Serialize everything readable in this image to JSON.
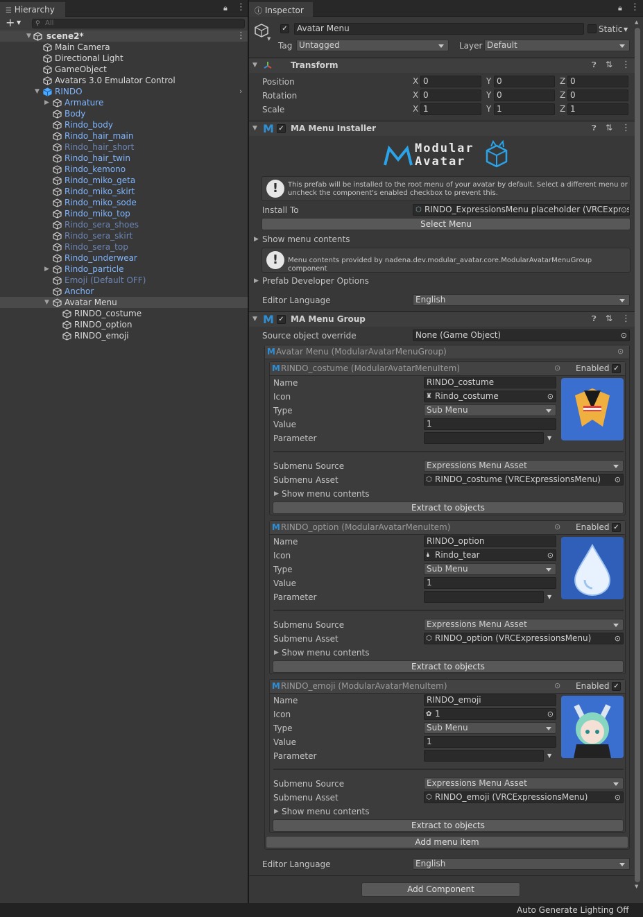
{
  "hierarchy": {
    "tab": "Hierarchy",
    "search_placeholder": "All",
    "scene": "scene2*",
    "rows": [
      {
        "label": "Main Camera",
        "indent": 1,
        "color": "white",
        "icon": "gameobject-icon"
      },
      {
        "label": "Directional Light",
        "indent": 1,
        "color": "white",
        "icon": "gameobject-icon"
      },
      {
        "label": "GameObject",
        "indent": 1,
        "color": "white",
        "icon": "gameobject-icon"
      },
      {
        "label": "Avatars 3.0 Emulator Control",
        "indent": 1,
        "color": "white",
        "icon": "gameobject-icon"
      },
      {
        "label": "RINDO",
        "indent": 1,
        "color": "blue",
        "icon": "prefab-icon",
        "expanded": true
      },
      {
        "label": "Armature",
        "indent": 2,
        "color": "blue",
        "icon": "gameobject-icon",
        "collapsed": true
      },
      {
        "label": "Body",
        "indent": 2,
        "color": "blue",
        "icon": "gameobject-icon"
      },
      {
        "label": "Rindo_body",
        "indent": 2,
        "color": "blue",
        "icon": "gameobject-icon"
      },
      {
        "label": "Rindo_hair_main",
        "indent": 2,
        "color": "blue",
        "icon": "gameobject-icon"
      },
      {
        "label": "Rindo_hair_short",
        "indent": 2,
        "color": "dim",
        "icon": "gameobject-icon"
      },
      {
        "label": "Rindo_hair_twin",
        "indent": 2,
        "color": "blue",
        "icon": "gameobject-icon"
      },
      {
        "label": "Rindo_kemono",
        "indent": 2,
        "color": "blue",
        "icon": "gameobject-icon"
      },
      {
        "label": "Rindo_miko_geta",
        "indent": 2,
        "color": "blue",
        "icon": "gameobject-icon"
      },
      {
        "label": "Rindo_miko_skirt",
        "indent": 2,
        "color": "blue",
        "icon": "gameobject-icon"
      },
      {
        "label": "Rindo_miko_sode",
        "indent": 2,
        "color": "blue",
        "icon": "gameobject-icon"
      },
      {
        "label": "Rindo_miko_top",
        "indent": 2,
        "color": "blue",
        "icon": "gameobject-icon"
      },
      {
        "label": "Rindo_sera_shoes",
        "indent": 2,
        "color": "dim",
        "icon": "gameobject-icon"
      },
      {
        "label": "Rindo_sera_skirt",
        "indent": 2,
        "color": "dim",
        "icon": "gameobject-icon"
      },
      {
        "label": "Rindo_sera_top",
        "indent": 2,
        "color": "dim",
        "icon": "gameobject-icon"
      },
      {
        "label": "Rindo_underwear",
        "indent": 2,
        "color": "blue",
        "icon": "gameobject-icon"
      },
      {
        "label": "Rindo_particle",
        "indent": 2,
        "color": "blue",
        "icon": "gameobject-icon",
        "collapsed": true
      },
      {
        "label": "Emoji (Default OFF)",
        "indent": 2,
        "color": "dim",
        "icon": "gameobject-icon"
      },
      {
        "label": "Anchor",
        "indent": 2,
        "color": "blue",
        "icon": "gameobject-icon"
      },
      {
        "label": "Avatar Menu",
        "indent": 2,
        "color": "white",
        "icon": "menu-group-icon",
        "expanded": true,
        "selected": true
      },
      {
        "label": "RINDO_costume",
        "indent": 3,
        "color": "white",
        "icon": "gameobject-icon"
      },
      {
        "label": "RINDO_option",
        "indent": 3,
        "color": "white",
        "icon": "gameobject-icon"
      },
      {
        "label": "RINDO_emoji",
        "indent": 3,
        "color": "white",
        "icon": "gameobject-icon"
      }
    ]
  },
  "inspector": {
    "tab": "Inspector",
    "object_name": "Avatar Menu",
    "static_label": "Static",
    "tag_label": "Tag",
    "tag_value": "Untagged",
    "layer_label": "Layer",
    "layer_value": "Default",
    "transform": {
      "title": "Transform",
      "rows": [
        {
          "label": "Position",
          "x": "0",
          "y": "0",
          "z": "0"
        },
        {
          "label": "Rotation",
          "x": "0",
          "y": "0",
          "z": "0"
        },
        {
          "label": "Scale",
          "x": "1",
          "y": "1",
          "z": "1"
        }
      ]
    },
    "installer": {
      "title": "MA Menu Installer",
      "logo_line1": "Modular",
      "logo_line2": "Avatar",
      "help1": "This prefab will be installed to the root menu of your avatar by default. Select a different menu or uncheck the component's enabled checkbox to prevent this.",
      "install_to_label": "Install To",
      "install_to_value": "RINDO_ExpressionsMenu placeholder (VRCExpres",
      "select_menu": "Select Menu",
      "show_menu_contents": "Show menu contents",
      "help2": "Menu contents provided by nadena.dev.modular_avatar.core.ModularAvatarMenuGroup component",
      "prefab_dev": "Prefab Developer Options",
      "editor_language_label": "Editor Language",
      "editor_language_value": "English"
    },
    "menu_group": {
      "title": "MA Menu Group",
      "source_label": "Source object override",
      "source_value": "None (Game Object)",
      "group_header": "Avatar Menu (ModularAvatarMenuGroup)",
      "enabled_label": "Enabled",
      "labels": {
        "name": "Name",
        "icon": "Icon",
        "type": "Type",
        "value": "Value",
        "parameter": "Parameter",
        "submenu_source": "Submenu Source",
        "submenu_asset": "Submenu Asset",
        "show_menu_contents": "Show menu contents",
        "extract": "Extract to objects"
      },
      "items": [
        {
          "header": "RINDO_costume (ModularAvatarMenuItem)",
          "name": "RINDO_costume",
          "icon": "Rindo_costume",
          "type": "Sub Menu",
          "value": "1",
          "submenu_source": "Expressions Menu Asset",
          "submenu_asset": "RINDO_costume (VRCExpressionsMenu)"
        },
        {
          "header": "RINDO_option (ModularAvatarMenuItem)",
          "name": "RINDO_option",
          "icon": "Rindo_tear",
          "type": "Sub Menu",
          "value": "1",
          "submenu_source": "Expressions Menu Asset",
          "submenu_asset": "RINDO_option (VRCExpressionsMenu)"
        },
        {
          "header": "RINDO_emoji (ModularAvatarMenuItem)",
          "name": "RINDO_emoji",
          "icon": "1",
          "type": "Sub Menu",
          "value": "1",
          "submenu_source": "Expressions Menu Asset",
          "submenu_asset": "RINDO_emoji (VRCExpressionsMenu)"
        }
      ],
      "add_menu_item": "Add menu item",
      "editor_language_label": "Editor Language",
      "editor_language_value": "English"
    },
    "add_component": "Add Component"
  },
  "status": {
    "text": "Auto Generate Lighting Off"
  },
  "colors": {
    "accent": "#2e8fd6",
    "prefab_blue": "#7fb6ff",
    "panel": "#383838"
  }
}
